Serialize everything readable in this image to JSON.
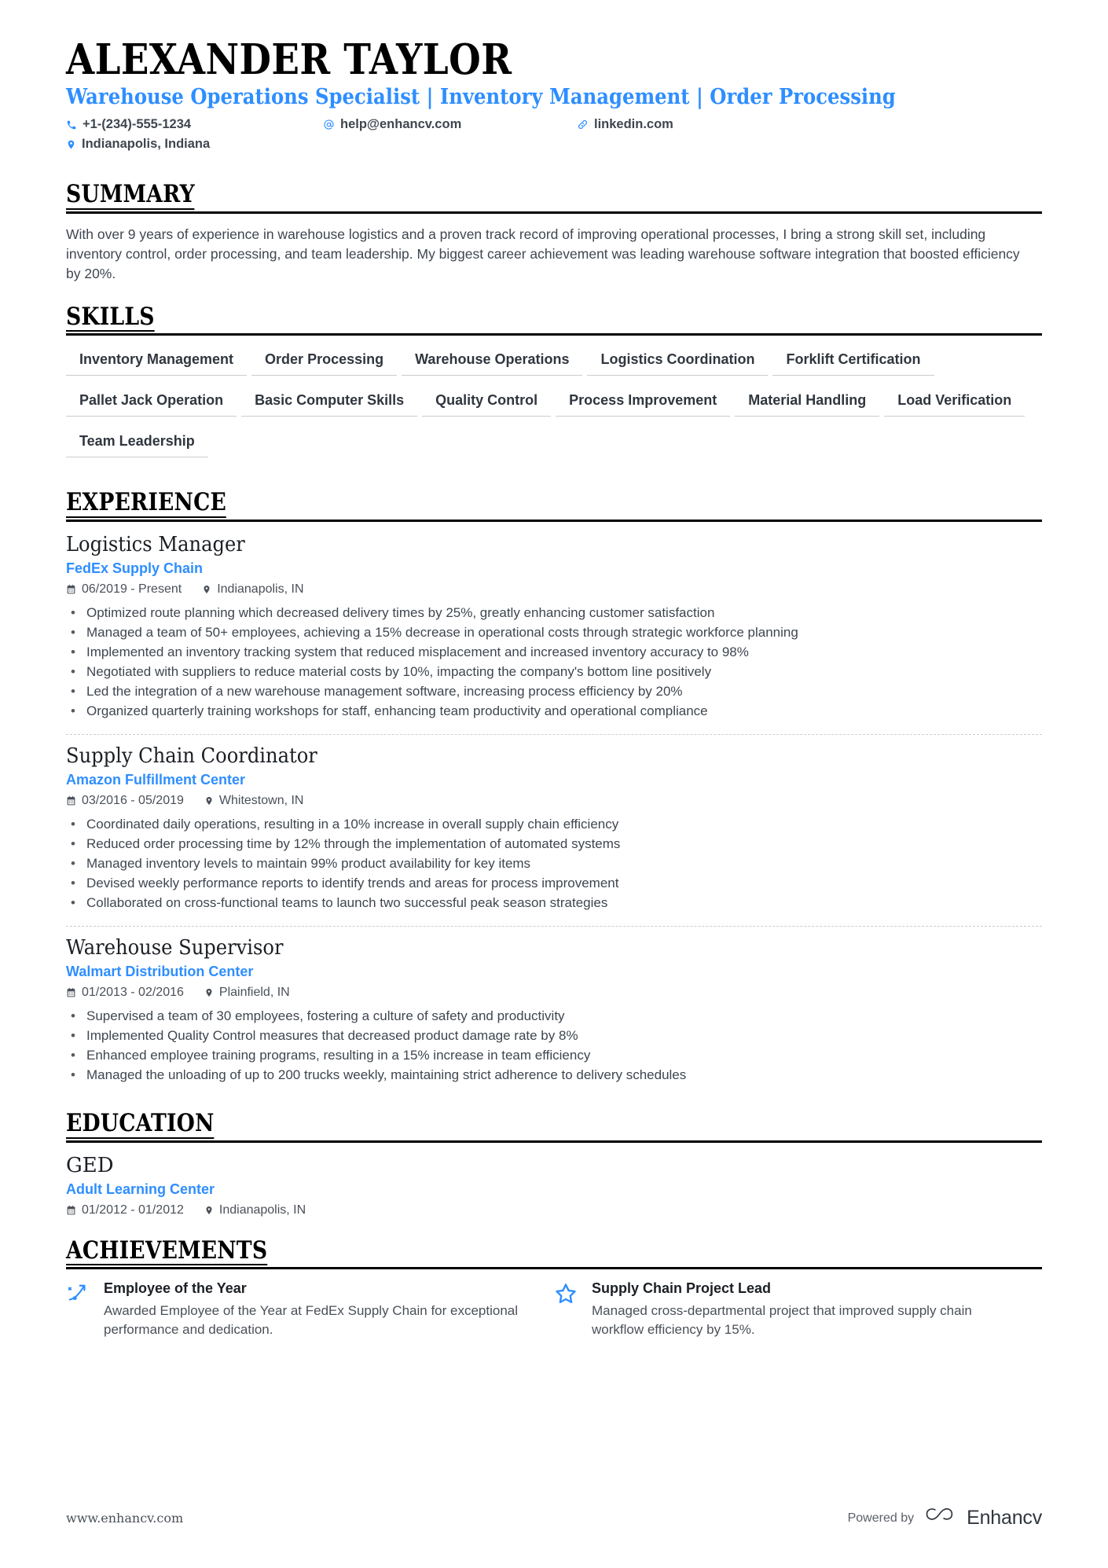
{
  "header": {
    "name": "ALEXANDER TAYLOR",
    "headline": "Warehouse Operations Specialist | Inventory Management | Order Processing",
    "contacts": {
      "phone": "+1-(234)-555-1234",
      "email": "help@enhancv.com",
      "linkedin": "linkedin.com",
      "location": "Indianapolis, Indiana"
    }
  },
  "sections": {
    "summary": {
      "title": "SUMMARY",
      "text": "With over 9 years of experience in warehouse logistics and a proven track record of improving operational processes, I bring a strong skill set, including inventory control, order processing, and team leadership. My biggest career achievement was leading warehouse software integration that boosted efficiency by 20%."
    },
    "skills": {
      "title": "SKILLS",
      "items": [
        "Inventory Management",
        "Order Processing",
        "Warehouse Operations",
        "Logistics Coordination",
        "Forklift Certification",
        "Pallet Jack Operation",
        "Basic Computer Skills",
        "Quality Control",
        "Process Improvement",
        "Material Handling",
        "Load Verification",
        "Team Leadership"
      ]
    },
    "experience": {
      "title": "EXPERIENCE",
      "entries": [
        {
          "job_title": "Logistics Manager",
          "company": "FedEx Supply Chain",
          "dates": "06/2019 - Present",
          "location": "Indianapolis, IN",
          "bullets": [
            "Optimized route planning which decreased delivery times by 25%, greatly enhancing customer satisfaction",
            "Managed a team of 50+ employees, achieving a 15% decrease in operational costs through strategic workforce planning",
            "Implemented an inventory tracking system that reduced misplacement and increased inventory accuracy to 98%",
            "Negotiated with suppliers to reduce material costs by 10%, impacting the company's bottom line positively",
            "Led the integration of a new warehouse management software, increasing process efficiency by 20%",
            "Organized quarterly training workshops for staff, enhancing team productivity and operational compliance"
          ]
        },
        {
          "job_title": "Supply Chain Coordinator",
          "company": "Amazon Fulfillment Center",
          "dates": "03/2016 - 05/2019",
          "location": "Whitestown, IN",
          "bullets": [
            "Coordinated daily operations, resulting in a 10% increase in overall supply chain efficiency",
            "Reduced order processing time by 12% through the implementation of automated systems",
            "Managed inventory levels to maintain 99% product availability for key items",
            "Devised weekly performance reports to identify trends and areas for process improvement",
            "Collaborated on cross-functional teams to launch two successful peak season strategies"
          ]
        },
        {
          "job_title": "Warehouse Supervisor",
          "company": "Walmart Distribution Center",
          "dates": "01/2013 - 02/2016",
          "location": "Plainfield, IN",
          "bullets": [
            "Supervised a team of 30 employees, fostering a culture of safety and productivity",
            "Implemented Quality Control measures that decreased product damage rate by 8%",
            "Enhanced employee training programs, resulting in a 15% increase in team efficiency",
            "Managed the unloading of up to 200 trucks weekly, maintaining strict adherence to delivery schedules"
          ]
        }
      ]
    },
    "education": {
      "title": "EDUCATION",
      "entries": [
        {
          "degree": "GED",
          "school": "Adult Learning Center",
          "dates": "01/2012 - 01/2012",
          "location": "Indianapolis, IN"
        }
      ]
    },
    "achievements": {
      "title": "ACHIEVEMENTS",
      "items": [
        {
          "icon": "rocket-trajectory-icon",
          "title": "Employee of the Year",
          "description": "Awarded Employee of the Year at FedEx Supply Chain for exceptional performance and dedication."
        },
        {
          "icon": "star-outline-icon",
          "title": "Supply Chain Project Lead",
          "description": "Managed cross-departmental project that improved supply chain workflow efficiency by 15%."
        }
      ]
    }
  },
  "footer": {
    "website": "www.enhancv.com",
    "powered_by": "Powered by",
    "brand": "Enhancv"
  },
  "colors": {
    "accent": "#2e8eff",
    "text": "#3f4650",
    "heading": "#000000",
    "rule": "#c9ccd1"
  }
}
